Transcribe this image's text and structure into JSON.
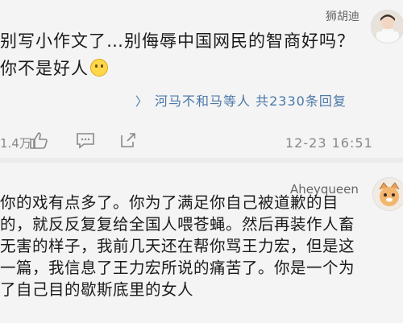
{
  "comment1": {
    "username": "狮胡迪",
    "text": "别写小作文了…别侮辱中国网民的智商好吗？你不是好人",
    "emoji": "slightly-smiling-face",
    "replies_text": "河马不和马等人  共2330条回复",
    "like_count": "1.4万",
    "timestamp": "12-23 16:51",
    "icons": [
      "thumbs-up-icon",
      "comment-icon",
      "share-icon"
    ]
  },
  "comment2": {
    "username": "Aheyqueen",
    "text": "你的戏有点多了。你为了满足你自己被道歉的目的，就反反复复给全国人喂苍蝇。然后再装作人畜无害的样子，我前几天还在帮你骂王力宏，但是这一篇，我信息了王力宏所说的痛苦了。你是一个为了自己目的歇斯底里的女人"
  },
  "colors": {
    "link": "#4a78a8",
    "meta": "#888888",
    "background": "#f4f4f4"
  }
}
